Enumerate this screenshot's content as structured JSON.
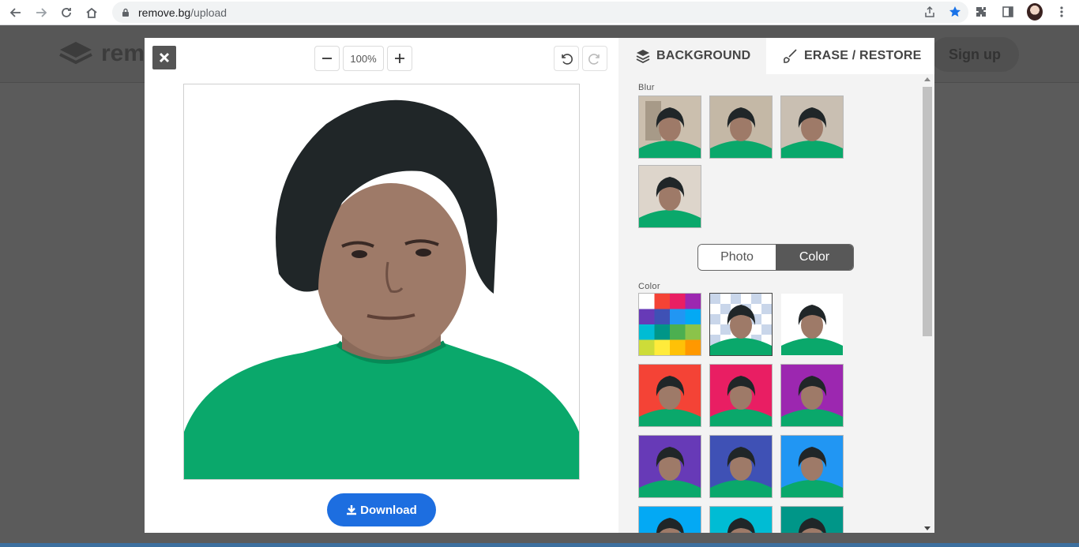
{
  "browser": {
    "url_host": "remove.bg",
    "url_path": "/upload"
  },
  "site": {
    "logo_text": "rem",
    "signup_label": "Sign up"
  },
  "toolbar": {
    "zoom_value": "100%"
  },
  "download_label": "Download",
  "tabs": {
    "background": "BACKGROUND",
    "erase_restore": "ERASE / RESTORE"
  },
  "panel": {
    "blur_label": "Blur",
    "color_label": "Color",
    "toggle": {
      "photo": "Photo",
      "color": "Color",
      "selected": "Color"
    }
  },
  "colors": {
    "accent": "#1d6ee0",
    "shirt": "#0aa86b",
    "tab_text": "#454545",
    "blur_bg": "#cbbfae",
    "color_swatches": [
      "#f44336",
      "#e91e63",
      "#9c27b0",
      "#673ab7",
      "#3f51b5",
      "#2196f3",
      "#03a9f4",
      "#00bcd4",
      "#009688"
    ],
    "palette_grid": [
      "#ffffff",
      "#f44336",
      "#e91e63",
      "#9c27b0",
      "#673ab7",
      "#3f51b5",
      "#2196f3",
      "#03a9f4",
      "#00bcd4",
      "#009688",
      "#4caf50",
      "#8bc34a",
      "#cddc39",
      "#ffeb3b",
      "#ffc107",
      "#ff9800"
    ]
  }
}
